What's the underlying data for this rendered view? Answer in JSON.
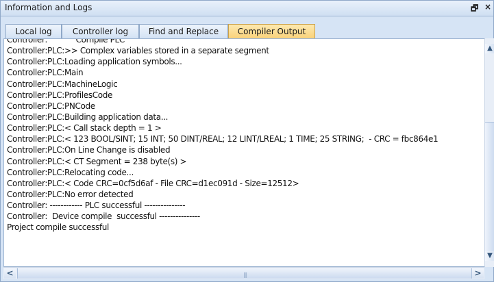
{
  "window": {
    "title": "Information and Logs",
    "restore_icon": "restore-icon",
    "close_icon": "close-icon",
    "restore_glyph": "🗗",
    "close_glyph": "×"
  },
  "tabs": [
    {
      "label": "Local log",
      "active": false
    },
    {
      "label": "Controller log",
      "active": false
    },
    {
      "label": "Find and Replace",
      "active": false
    },
    {
      "label": "Compiler Output",
      "active": true
    }
  ],
  "output_lines": [
    "Controller:            Compile PLC",
    "Controller:PLC:>> Complex variables stored in a separate segment",
    "Controller:PLC:Loading application symbols...",
    "Controller:PLC:Main",
    "Controller:PLC:MachineLogic",
    "Controller:PLC:ProfilesCode",
    "Controller:PLC:PNCode",
    "Controller:PLC:Building application data...",
    "Controller:PLC:< Call stack depth = 1 >",
    "Controller:PLC:< 123 BOOL/SINT; 15 INT; 50 DINT/REAL; 12 LINT/LREAL; 1 TIME; 25 STRING;  - CRC = fbc864e1",
    "Controller:PLC:On Line Change is disabled",
    "Controller:PLC:< CT Segment = 238 byte(s) >",
    "Controller:PLC:Relocating code...",
    "Controller:PLC:< Code CRC=0cf5d6af - File CRC=d1ec091d - Size=12512>",
    "Controller:PLC:No error detected",
    "Controller: ------------ PLC successful ---------------",
    "Controller:  Device compile  successful ---------------",
    "Project compile successful"
  ],
  "scrollbars": {
    "up_arrow": "▲",
    "down_arrow": "▼",
    "left_arrow": "<",
    "right_arrow": ">"
  }
}
